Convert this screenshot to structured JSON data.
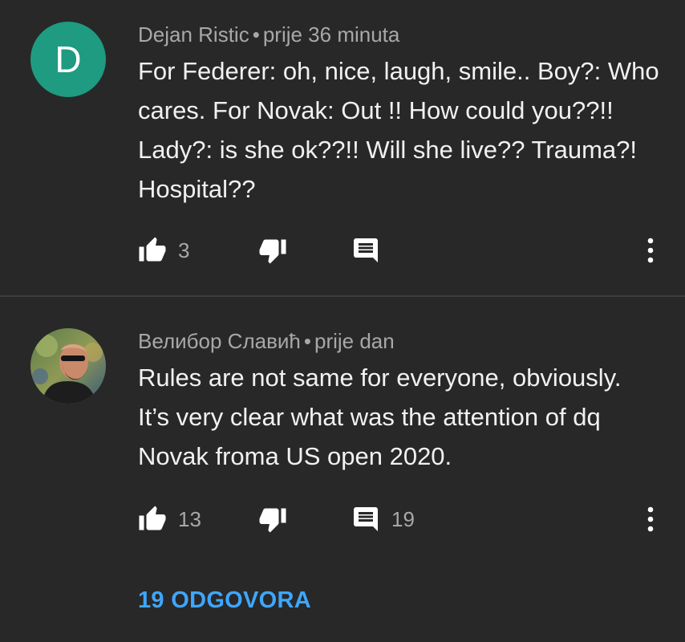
{
  "comments": [
    {
      "avatar_letter": "D",
      "avatar_color": "#1e9b80",
      "author": "Dejan Ristic",
      "time": "prije 36 minuta",
      "text": "For Federer: oh, nice, laugh, smile.. Boy?: Who cares. For Novak: Out !! How  could you??!! Lady?: is she ok??!! Will she live?? Trauma?! Hospital??",
      "likes": "3",
      "replies_count": ""
    },
    {
      "avatar_letter": "",
      "author": "Велибор Славић",
      "time": "prije dan",
      "text": "Rules are not same for everyone, obviously. It’s very clear what was the attention of dq Novak froma US open 2020.",
      "likes": "13",
      "replies_count": "19",
      "replies_link": "19 ODGOVORA"
    }
  ],
  "separator": "•",
  "icons": {
    "like": "thumbs-up-icon",
    "dislike": "thumbs-down-icon",
    "reply": "comment-icon",
    "more": "more-vertical-icon"
  },
  "colors": {
    "background": "#282828",
    "link": "#3ea6ff",
    "meta": "#a8a8a8"
  }
}
